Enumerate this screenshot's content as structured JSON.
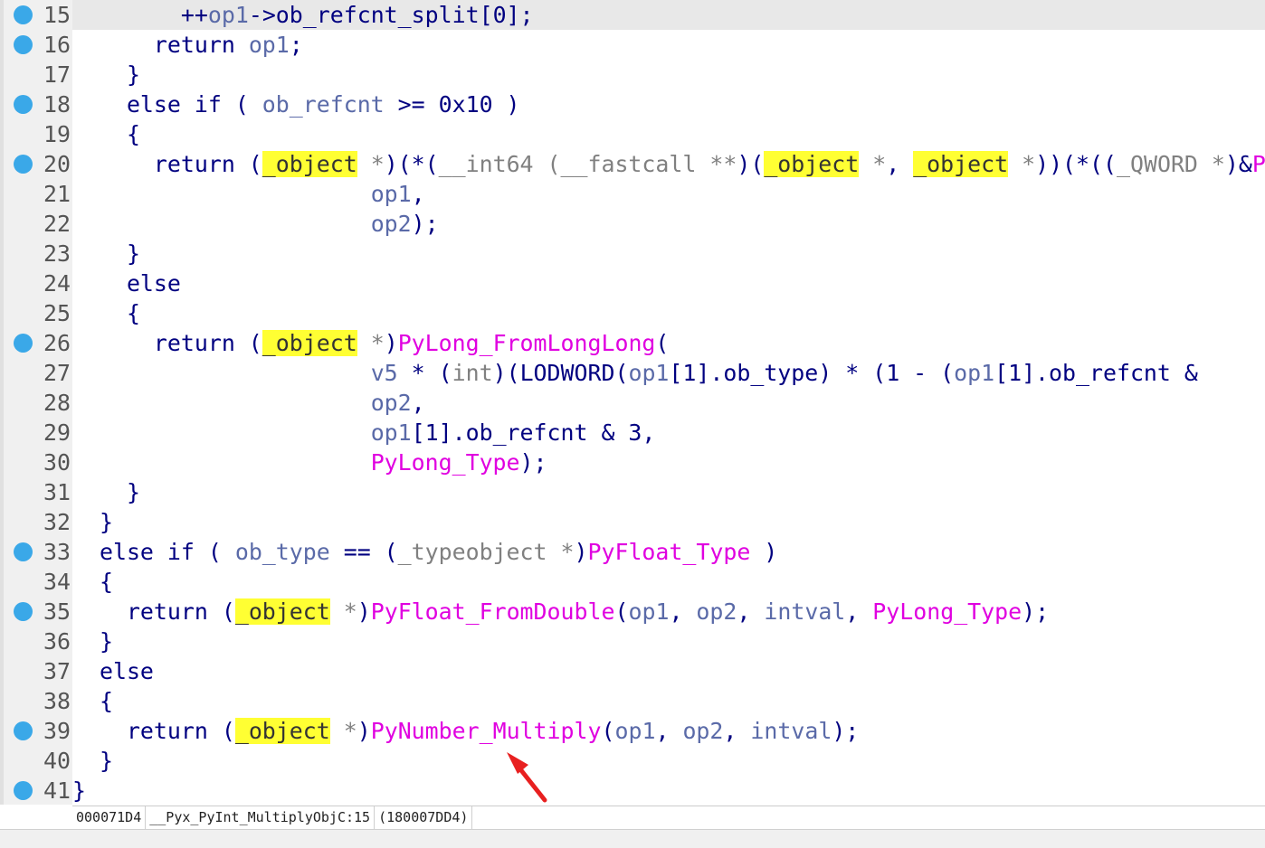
{
  "editor": {
    "lines": [
      {
        "num": "15",
        "bp": true,
        "tokens": [
          [
            "k",
            "        ++"
          ],
          [
            "v",
            "op1"
          ],
          [
            "k",
            "->ob_refcnt_split[0];"
          ]
        ]
      },
      {
        "num": "16",
        "bp": true,
        "tokens": [
          [
            "k",
            "      return "
          ],
          [
            "v",
            "op1"
          ],
          [
            "k",
            ";"
          ]
        ]
      },
      {
        "num": "17",
        "bp": false,
        "tokens": [
          [
            "k",
            "    }"
          ]
        ]
      },
      {
        "num": "18",
        "bp": true,
        "tokens": [
          [
            "k",
            "    else if ( "
          ],
          [
            "v",
            "ob_refcnt"
          ],
          [
            "k",
            " >= 0x10 )"
          ]
        ]
      },
      {
        "num": "19",
        "bp": false,
        "tokens": [
          [
            "k",
            "    {"
          ]
        ]
      },
      {
        "num": "20",
        "bp": true,
        "tokens": [
          [
            "k",
            "      return ("
          ],
          [
            "hl",
            "_object"
          ],
          [
            "t",
            " *"
          ],
          [
            "k",
            ")(*("
          ],
          [
            "t",
            "__int64 (__fastcall **"
          ],
          [
            "k",
            ")("
          ],
          [
            "hl",
            "_object"
          ],
          [
            "t",
            " *"
          ],
          [
            "k",
            ", "
          ],
          [
            "hl",
            "_object"
          ],
          [
            "t",
            " *"
          ],
          [
            "k",
            "))(*(("
          ],
          [
            "t",
            "_QWORD *"
          ],
          [
            "k",
            ")&"
          ],
          [
            "f",
            "P"
          ]
        ]
      },
      {
        "num": "21",
        "bp": false,
        "tokens": [
          [
            "k",
            "                      "
          ],
          [
            "v",
            "op1"
          ],
          [
            "k",
            ","
          ]
        ]
      },
      {
        "num": "22",
        "bp": false,
        "tokens": [
          [
            "k",
            "                      "
          ],
          [
            "v",
            "op2"
          ],
          [
            "k",
            ");"
          ]
        ]
      },
      {
        "num": "23",
        "bp": false,
        "tokens": [
          [
            "k",
            "    }"
          ]
        ]
      },
      {
        "num": "24",
        "bp": false,
        "tokens": [
          [
            "k",
            "    else"
          ]
        ]
      },
      {
        "num": "25",
        "bp": false,
        "tokens": [
          [
            "k",
            "    {"
          ]
        ]
      },
      {
        "num": "26",
        "bp": true,
        "tokens": [
          [
            "k",
            "      return ("
          ],
          [
            "hl",
            "_object"
          ],
          [
            "t",
            " *"
          ],
          [
            "k",
            ")"
          ],
          [
            "f",
            "PyLong_FromLongLong"
          ],
          [
            "k",
            "("
          ]
        ]
      },
      {
        "num": "27",
        "bp": false,
        "tokens": [
          [
            "k",
            "                      "
          ],
          [
            "v",
            "v5"
          ],
          [
            "k",
            " * ("
          ],
          [
            "t",
            "int"
          ],
          [
            "k",
            ")(LODWORD("
          ],
          [
            "v",
            "op1"
          ],
          [
            "k",
            "[1].ob_type) * (1 - ("
          ],
          [
            "v",
            "op1"
          ],
          [
            "k",
            "[1].ob_refcnt &"
          ]
        ]
      },
      {
        "num": "28",
        "bp": false,
        "tokens": [
          [
            "k",
            "                      "
          ],
          [
            "v",
            "op2"
          ],
          [
            "k",
            ","
          ]
        ]
      },
      {
        "num": "29",
        "bp": false,
        "tokens": [
          [
            "k",
            "                      "
          ],
          [
            "v",
            "op1"
          ],
          [
            "k",
            "[1].ob_refcnt & 3,"
          ]
        ]
      },
      {
        "num": "30",
        "bp": false,
        "tokens": [
          [
            "k",
            "                      "
          ],
          [
            "f",
            "PyLong_Type"
          ],
          [
            "k",
            ");"
          ]
        ]
      },
      {
        "num": "31",
        "bp": false,
        "tokens": [
          [
            "k",
            "    }"
          ]
        ]
      },
      {
        "num": "32",
        "bp": false,
        "tokens": [
          [
            "k",
            "  }"
          ]
        ]
      },
      {
        "num": "33",
        "bp": true,
        "tokens": [
          [
            "k",
            "  else if ( "
          ],
          [
            "v",
            "ob_type"
          ],
          [
            "k",
            " == ("
          ],
          [
            "t",
            "_typeobject *"
          ],
          [
            "k",
            ")"
          ],
          [
            "f",
            "PyFloat_Type"
          ],
          [
            "k",
            " )"
          ]
        ]
      },
      {
        "num": "34",
        "bp": false,
        "tokens": [
          [
            "k",
            "  {"
          ]
        ]
      },
      {
        "num": "35",
        "bp": true,
        "tokens": [
          [
            "k",
            "    return ("
          ],
          [
            "hl",
            "_object"
          ],
          [
            "t",
            " *"
          ],
          [
            "k",
            ")"
          ],
          [
            "f",
            "PyFloat_FromDouble"
          ],
          [
            "k",
            "("
          ],
          [
            "v",
            "op1"
          ],
          [
            "k",
            ", "
          ],
          [
            "v",
            "op2"
          ],
          [
            "k",
            ", "
          ],
          [
            "v",
            "intval"
          ],
          [
            "k",
            ", "
          ],
          [
            "f",
            "PyLong_Type"
          ],
          [
            "k",
            ");"
          ]
        ]
      },
      {
        "num": "36",
        "bp": false,
        "tokens": [
          [
            "k",
            "  }"
          ]
        ]
      },
      {
        "num": "37",
        "bp": false,
        "tokens": [
          [
            "k",
            "  else"
          ]
        ]
      },
      {
        "num": "38",
        "bp": false,
        "tokens": [
          [
            "k",
            "  {"
          ]
        ]
      },
      {
        "num": "39",
        "bp": true,
        "tokens": [
          [
            "k",
            "    return ("
          ],
          [
            "hl",
            "_object"
          ],
          [
            "t",
            " *"
          ],
          [
            "k",
            ")"
          ],
          [
            "f",
            "PyNumber_Multiply"
          ],
          [
            "k",
            "("
          ],
          [
            "v",
            "op1"
          ],
          [
            "k",
            ", "
          ],
          [
            "v",
            "op2"
          ],
          [
            "k",
            ", "
          ],
          [
            "v",
            "intval"
          ],
          [
            "k",
            ");"
          ]
        ]
      },
      {
        "num": "40",
        "bp": false,
        "tokens": [
          [
            "k",
            "  }"
          ]
        ]
      },
      {
        "num": "41",
        "bp": true,
        "tokens": [
          [
            "k",
            "}"
          ]
        ]
      }
    ],
    "current_line_index": 0
  },
  "status": {
    "address": "000071D4",
    "location": "__Pyx_PyInt_MultiplyObjC:15",
    "ea": "(180007DD4)"
  },
  "colors": {
    "keyword": "#000080",
    "variable": "#5a6aa8",
    "function": "#e000e0",
    "type": "#808080",
    "highlight": "#ffff33",
    "breakpoint": "#3aa8e8",
    "arrow": "#e82020"
  }
}
